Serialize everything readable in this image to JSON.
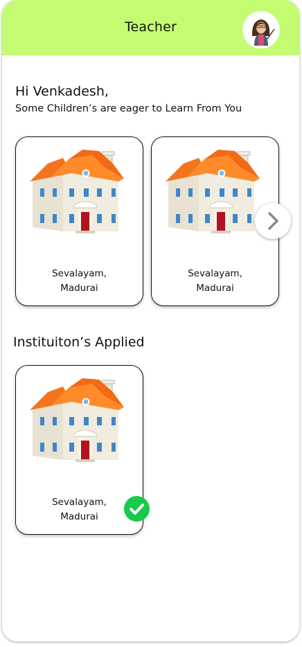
{
  "header": {
    "title": "Teacher",
    "avatar_icon": "teacher-avatar-icon",
    "bg_color": "#c3fc71"
  },
  "greeting": "Hi Venkadesh,",
  "subtitle": "Some Children’s are eager to Learn From You",
  "institutions": [
    {
      "line1": "Sevalayam,",
      "line2": "Madurai"
    },
    {
      "line1": "Sevalayam,",
      "line2": "Madurai"
    }
  ],
  "next_icon": "chevron-right-icon",
  "applied": {
    "title": "Instituiton’s Applied",
    "items": [
      {
        "line1": "Sevalayam,",
        "line2": "Madurai",
        "status_icon": "check-icon",
        "status_color": "#19c94b"
      }
    ]
  }
}
